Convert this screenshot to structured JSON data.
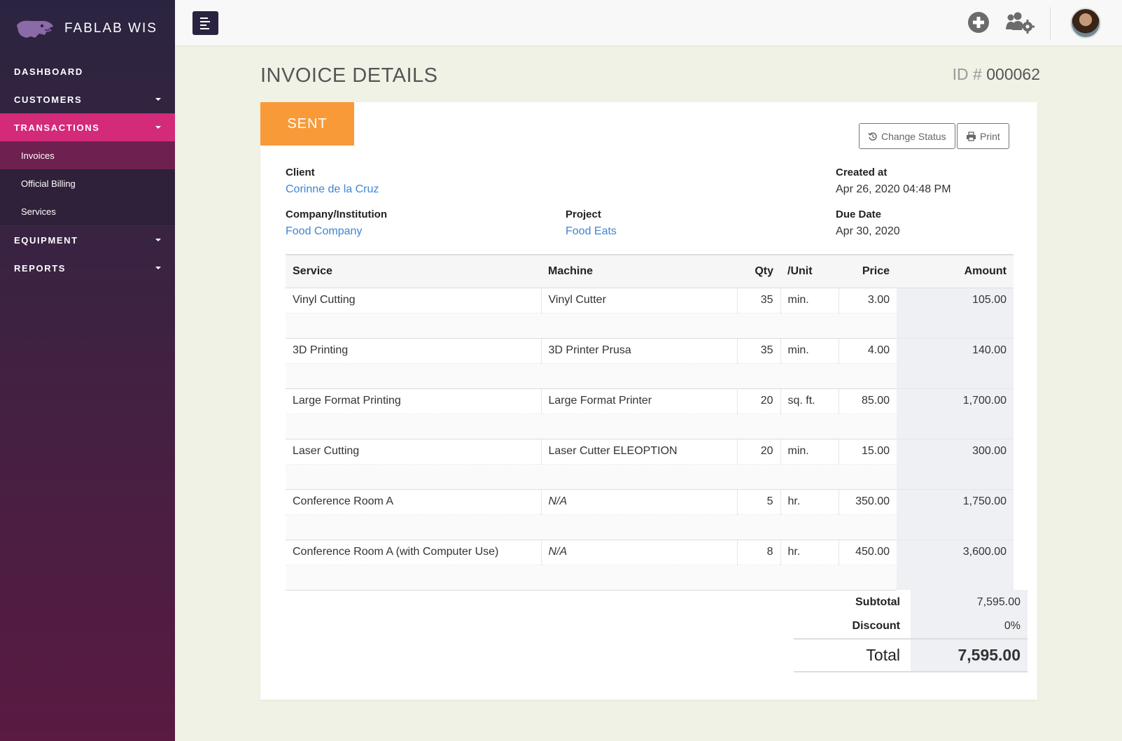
{
  "brand": {
    "name": "FABLAB WIS"
  },
  "sidebar": {
    "items": [
      {
        "label": "DASHBOARD"
      },
      {
        "label": "CUSTOMERS"
      },
      {
        "label": "TRANSACTIONS"
      },
      {
        "label": "EQUIPMENT"
      },
      {
        "label": "REPORTS"
      }
    ],
    "sub_items": [
      {
        "label": "Invoices"
      },
      {
        "label": "Official Billing"
      },
      {
        "label": "Services"
      }
    ]
  },
  "topbar": {
    "icons": [
      "menu-icon",
      "plus-circle-icon",
      "users-gear-icon",
      "avatar"
    ]
  },
  "page": {
    "title": "INVOICE DETAILS",
    "id_label": "ID #",
    "id_value": "000062"
  },
  "invoice": {
    "status": "SENT",
    "change_status_label": "Change Status",
    "print_label": "Print",
    "client_label": "Client",
    "client": "Corinne de la Cruz",
    "created_label": "Created at",
    "created": "Apr 26, 2020 04:48 PM",
    "company_label": "Company/Institution",
    "company": "Food Company",
    "project_label": "Project",
    "project": "Food Eats",
    "due_label": "Due Date",
    "due": "Apr 30, 2020"
  },
  "table": {
    "headers": {
      "service": "Service",
      "machine": "Machine",
      "qty": "Qty",
      "unit": "/Unit",
      "price": "Price",
      "amount": "Amount"
    },
    "rows": [
      {
        "service": "Vinyl Cutting",
        "machine": "Vinyl Cutter",
        "qty": "35",
        "unit": "min.",
        "price": "3.00",
        "amount": "105.00"
      },
      {
        "service": "3D Printing",
        "machine": "3D Printer Prusa",
        "qty": "35",
        "unit": "min.",
        "price": "4.00",
        "amount": "140.00"
      },
      {
        "service": "Large Format Printing",
        "machine": "Large Format Printer",
        "qty": "20",
        "unit": "sq. ft.",
        "price": "85.00",
        "amount": "1,700.00"
      },
      {
        "service": "Laser Cutting",
        "machine": "Laser Cutter ELEOPTION",
        "qty": "20",
        "unit": "min.",
        "price": "15.00",
        "amount": "300.00"
      },
      {
        "service": "Conference Room A",
        "machine": "N/A",
        "qty": "5",
        "unit": "hr.",
        "price": "350.00",
        "amount": "1,750.00"
      },
      {
        "service": "Conference Room A (with Computer Use)",
        "machine": "N/A",
        "qty": "8",
        "unit": "hr.",
        "price": "450.00",
        "amount": "3,600.00"
      }
    ]
  },
  "totals": {
    "subtotal_label": "Subtotal",
    "subtotal": "7,595.00",
    "discount_label": "Discount",
    "discount": "0%",
    "total_label": "Total",
    "total": "7,595.00"
  },
  "colors": {
    "accent": "#d42a7a",
    "status": "#f99a38",
    "link": "#3b86d6"
  }
}
